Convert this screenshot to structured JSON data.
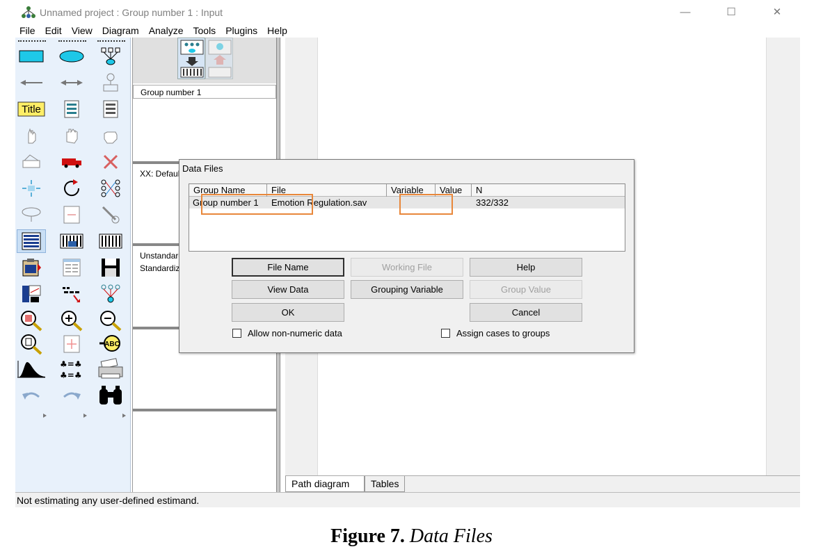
{
  "window": {
    "title": "Unnamed project : Group number 1 : Input",
    "min_glyph": "—",
    "max_glyph": "☐",
    "close_glyph": "✕"
  },
  "menu": [
    "File",
    "Edit",
    "View",
    "Diagram",
    "Analyze",
    "Tools",
    "Plugins",
    "Help"
  ],
  "toolbox": {
    "title_tool_label": "Title",
    "abc_label": "ABC"
  },
  "middle_panel": {
    "group_label": "Group number 1",
    "model_label": "XX: Default model",
    "estimate_1": "Unstandardized estimates",
    "estimate_2": "Standardized estimates"
  },
  "tabs": {
    "path": "Path diagram",
    "tables": "Tables"
  },
  "status": "Not estimating any user-defined estimand.",
  "dialog": {
    "title": "Data Files",
    "columns": [
      "Group Name",
      "File",
      "Variable",
      "Value",
      "N"
    ],
    "rows": [
      {
        "group": "Group number 1",
        "file": "Emotion Regulation.sav",
        "variable": "",
        "value": "",
        "n": "332/332"
      }
    ],
    "buttons": {
      "file_name": "File Name",
      "working_file": "Working File",
      "help": "Help",
      "view_data": "View Data",
      "grouping_variable": "Grouping Variable",
      "group_value": "Group Value",
      "ok": "OK",
      "cancel": "Cancel"
    },
    "checkboxes": {
      "non_numeric": "Allow non-numeric data",
      "assign_cases": "Assign cases to groups"
    },
    "highlight_color": "#e8873a"
  },
  "caption": {
    "label": "Figure 7.",
    "title": "Data Files"
  }
}
